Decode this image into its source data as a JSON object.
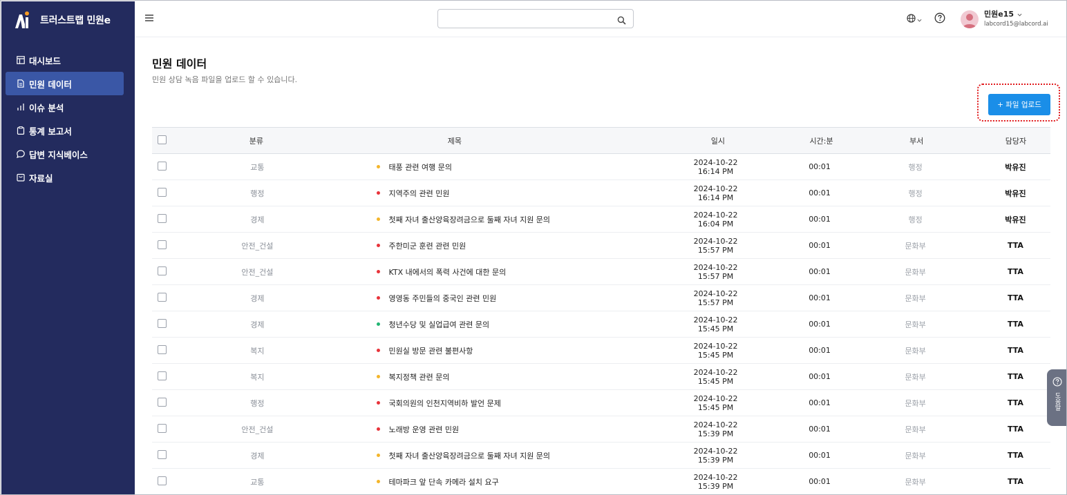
{
  "brand": {
    "name": "트러스트랩 민원e"
  },
  "sidebar": {
    "items": [
      {
        "label": "대시보드",
        "icon": "layout-icon",
        "active": false
      },
      {
        "label": "민원 데이터",
        "icon": "document-icon",
        "active": true
      },
      {
        "label": "이슈 분석",
        "icon": "bar-chart-icon",
        "active": false
      },
      {
        "label": "통계 보고서",
        "icon": "clipboard-icon",
        "active": false
      },
      {
        "label": "답변 지식베이스",
        "icon": "chat-bubble-icon",
        "active": false
      },
      {
        "label": "자료실",
        "icon": "archive-icon",
        "active": false
      }
    ]
  },
  "header": {
    "search": {
      "value": "",
      "placeholder": ""
    },
    "user": {
      "name": "민원e15",
      "email": "labcord15@labcord.ai"
    }
  },
  "page": {
    "title": "민원 데이터",
    "subtitle": "민원 상담 녹음 파일을 업로드 할 수 있습니다.",
    "upload_label": "+ 파일 업로드"
  },
  "table": {
    "headers": {
      "category": "분류",
      "title": "제목",
      "datetime": "일시",
      "duration": "시간:분",
      "department": "부서",
      "owner": "담당자"
    },
    "rows": [
      {
        "category": "교통",
        "dot": "yellow",
        "title": "태풍 관련 여행 문의",
        "datetime": "2024-10-22 16:14 PM",
        "duration": "00:01",
        "department": "행정",
        "owner": "박유진"
      },
      {
        "category": "행정",
        "dot": "red",
        "title": "지역주의 관련 민원",
        "datetime": "2024-10-22 16:14 PM",
        "duration": "00:01",
        "department": "행정",
        "owner": "박유진"
      },
      {
        "category": "경제",
        "dot": "yellow",
        "title": "첫째 자녀 출산양육장려금으로 둘째 자녀 지원 문의",
        "datetime": "2024-10-22 16:04 PM",
        "duration": "00:01",
        "department": "행정",
        "owner": "박유진"
      },
      {
        "category": "안전_건설",
        "dot": "red",
        "title": "주한미군 훈련 관련 민원",
        "datetime": "2024-10-22 15:57 PM",
        "duration": "00:01",
        "department": "문화부",
        "owner": "TTA"
      },
      {
        "category": "안전_건설",
        "dot": "red",
        "title": "KTX 내에서의 폭력 사건에 대한 문의",
        "datetime": "2024-10-22 15:57 PM",
        "duration": "00:01",
        "department": "문화부",
        "owner": "TTA"
      },
      {
        "category": "경제",
        "dot": "red",
        "title": "영영동 주민들의 중국인 관련 민원",
        "datetime": "2024-10-22 15:57 PM",
        "duration": "00:01",
        "department": "문화부",
        "owner": "TTA"
      },
      {
        "category": "경제",
        "dot": "green",
        "title": "청년수당 및 실업급여 관련 문의",
        "datetime": "2024-10-22 15:45 PM",
        "duration": "00:01",
        "department": "문화부",
        "owner": "TTA"
      },
      {
        "category": "복지",
        "dot": "red",
        "title": "민원실 방문 관련 불편사항",
        "datetime": "2024-10-22 15:45 PM",
        "duration": "00:01",
        "department": "문화부",
        "owner": "TTA"
      },
      {
        "category": "복지",
        "dot": "yellow",
        "title": "복지정책 관련 문의",
        "datetime": "2024-10-22 15:45 PM",
        "duration": "00:01",
        "department": "문화부",
        "owner": "TTA"
      },
      {
        "category": "행정",
        "dot": "red",
        "title": "국회의원의 인천지역비하 발언 문제",
        "datetime": "2024-10-22 15:45 PM",
        "duration": "00:01",
        "department": "문화부",
        "owner": "TTA"
      },
      {
        "category": "안전_건설",
        "dot": "red",
        "title": "노래방 운영 관련 민원",
        "datetime": "2024-10-22 15:39 PM",
        "duration": "00:01",
        "department": "문화부",
        "owner": "TTA"
      },
      {
        "category": "경제",
        "dot": "yellow",
        "title": "첫째 자녀 출산양육장려금으로 둘째 자녀 지원 문의",
        "datetime": "2024-10-22 15:39 PM",
        "duration": "00:01",
        "department": "문화부",
        "owner": "TTA"
      },
      {
        "category": "교통",
        "dot": "yellow",
        "title": "테마파크 앞 단속 카메라 설치 요구",
        "datetime": "2024-10-22 15:39 PM",
        "duration": "00:01",
        "department": "문화부",
        "owner": "TTA"
      }
    ]
  },
  "help_tab": {
    "label": "도움말"
  },
  "colors": {
    "sidebar": "#232b5e",
    "active_nav": "#3a57a6",
    "accent": "#1a8ee8",
    "focus_outline": "#e0181b"
  }
}
